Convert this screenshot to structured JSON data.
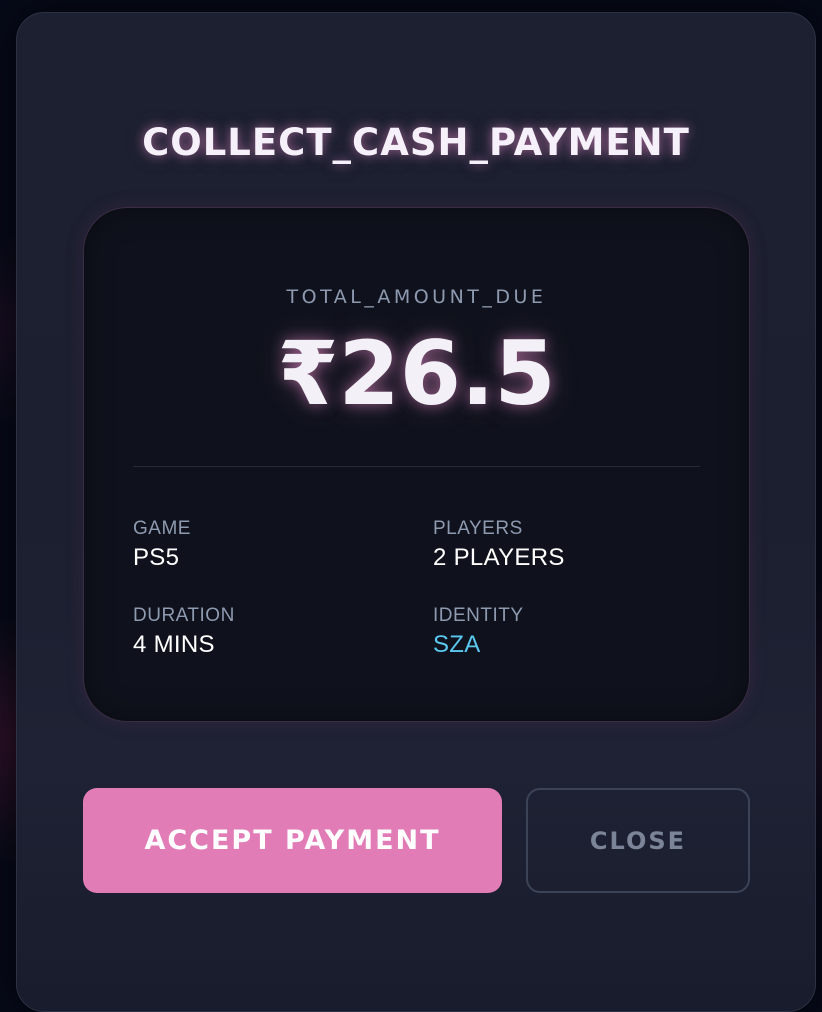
{
  "modal": {
    "title": "COLLECT_CASH_PAYMENT",
    "summary": {
      "due_label": "TOTAL_AMOUNT_DUE",
      "amount": "₹26.5"
    },
    "details": {
      "game": {
        "label": "GAME",
        "value": "PS5"
      },
      "players": {
        "label": "PLAYERS",
        "value": "2 PLAYERS"
      },
      "duration": {
        "label": "DURATION",
        "value": "4 MINS"
      },
      "identity": {
        "label": "IDENTITY",
        "value": "SZA"
      }
    },
    "actions": {
      "accept_label": "ACCEPT PAYMENT",
      "close_label": "CLOSE"
    }
  },
  "colors": {
    "accent_pink": "#e27cb7",
    "identity_cyan": "#5ac8f0",
    "background": "#060a18"
  }
}
